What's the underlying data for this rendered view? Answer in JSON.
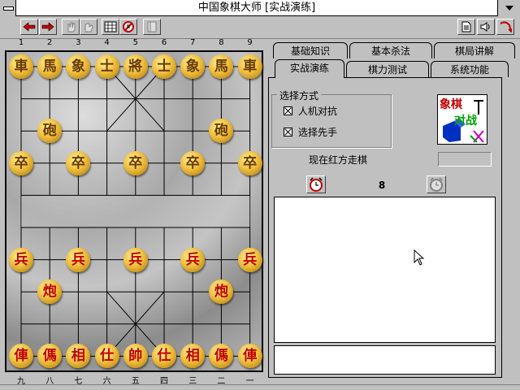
{
  "window": {
    "title": "中国象棋大师 [实战演练]"
  },
  "toolbar": {
    "left_buttons": [
      "undo-arrow-icon",
      "redo-arrow-icon",
      "hand-icon",
      "hand-icon-2",
      "board-icon",
      "stop-icon",
      "book-icon"
    ],
    "right_buttons": [
      "document-icon",
      "sound-icon",
      "exit-icon"
    ]
  },
  "board": {
    "files_top": [
      "1",
      "2",
      "3",
      "4",
      "5",
      "6",
      "7",
      "8",
      "9"
    ],
    "files_bottom": [
      "九",
      "八",
      "七",
      "六",
      "五",
      "四",
      "三",
      "二",
      "一"
    ],
    "pieces": [
      {
        "char": "車",
        "side": "black",
        "file": 0,
        "rank": 0
      },
      {
        "char": "馬",
        "side": "black",
        "file": 1,
        "rank": 0
      },
      {
        "char": "象",
        "side": "black",
        "file": 2,
        "rank": 0
      },
      {
        "char": "士",
        "side": "black",
        "file": 3,
        "rank": 0
      },
      {
        "char": "將",
        "side": "black",
        "file": 4,
        "rank": 0
      },
      {
        "char": "士",
        "side": "black",
        "file": 5,
        "rank": 0
      },
      {
        "char": "象",
        "side": "black",
        "file": 6,
        "rank": 0
      },
      {
        "char": "馬",
        "side": "black",
        "file": 7,
        "rank": 0
      },
      {
        "char": "車",
        "side": "black",
        "file": 8,
        "rank": 0
      },
      {
        "char": "砲",
        "side": "black",
        "file": 1,
        "rank": 2
      },
      {
        "char": "砲",
        "side": "black",
        "file": 7,
        "rank": 2
      },
      {
        "char": "卒",
        "side": "black",
        "file": 0,
        "rank": 3
      },
      {
        "char": "卒",
        "side": "black",
        "file": 2,
        "rank": 3
      },
      {
        "char": "卒",
        "side": "black",
        "file": 4,
        "rank": 3
      },
      {
        "char": "卒",
        "side": "black",
        "file": 6,
        "rank": 3
      },
      {
        "char": "卒",
        "side": "black",
        "file": 8,
        "rank": 3
      },
      {
        "char": "兵",
        "side": "red",
        "file": 0,
        "rank": 6
      },
      {
        "char": "兵",
        "side": "red",
        "file": 2,
        "rank": 6
      },
      {
        "char": "兵",
        "side": "red",
        "file": 4,
        "rank": 6
      },
      {
        "char": "兵",
        "side": "red",
        "file": 6,
        "rank": 6
      },
      {
        "char": "兵",
        "side": "red",
        "file": 8,
        "rank": 6
      },
      {
        "char": "炮",
        "side": "red",
        "file": 1,
        "rank": 7
      },
      {
        "char": "炮",
        "side": "red",
        "file": 7,
        "rank": 7
      },
      {
        "char": "俥",
        "side": "red",
        "file": 0,
        "rank": 9
      },
      {
        "char": "傌",
        "side": "red",
        "file": 1,
        "rank": 9
      },
      {
        "char": "相",
        "side": "red",
        "file": 2,
        "rank": 9
      },
      {
        "char": "仕",
        "side": "red",
        "file": 3,
        "rank": 9
      },
      {
        "char": "帥",
        "side": "red",
        "file": 4,
        "rank": 9
      },
      {
        "char": "仕",
        "side": "red",
        "file": 5,
        "rank": 9
      },
      {
        "char": "相",
        "side": "red",
        "file": 6,
        "rank": 9
      },
      {
        "char": "傌",
        "side": "red",
        "file": 7,
        "rank": 9
      },
      {
        "char": "俥",
        "side": "red",
        "file": 8,
        "rank": 9
      }
    ]
  },
  "tabs": {
    "row1": [
      "基础知识",
      "基本杀法",
      "棋局讲解"
    ],
    "row2": [
      "实战演练",
      "棋力测试",
      "系统功能"
    ],
    "active": "实战演练"
  },
  "select_mode": {
    "title": "选择方式",
    "options": [
      {
        "label": "人机对抗",
        "checked": true
      },
      {
        "label": "选择先手",
        "checked": true
      }
    ]
  },
  "logo": {
    "line1": "象棋",
    "line2": "对战"
  },
  "status": {
    "text": "现在红方走棋",
    "value": ""
  },
  "timer": {
    "count": "8"
  },
  "move_list": [],
  "message": ""
}
